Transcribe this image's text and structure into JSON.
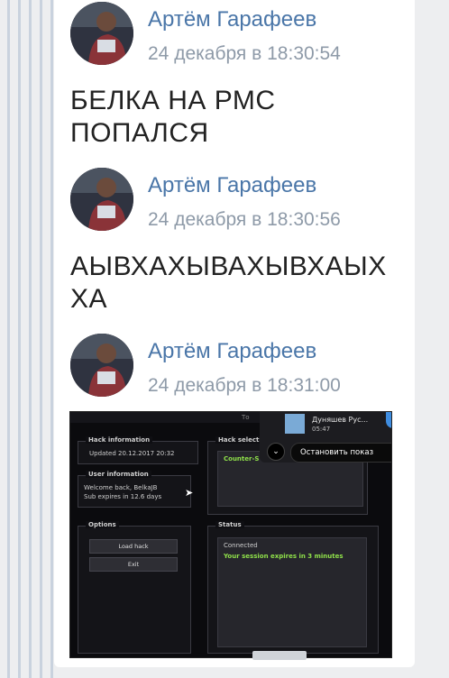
{
  "messages": [
    {
      "author": "Артём Гарафеев",
      "timestamp": "24 декабря в 18:30:54",
      "text_lines": [
        "БЕЛКА НА РМС",
        "ПОПАЛСЯ"
      ]
    },
    {
      "author": "Артём Гарафеев",
      "timestamp": "24 декабря в 18:30:56",
      "text_lines": [
        "АЫВХАХЫВАХЫВХАЫХ",
        "ХА"
      ]
    },
    {
      "author": "Артём Гарафеев",
      "timestamp": "24 декабря в 18:31:00"
    }
  ],
  "attachment": {
    "hack_information": {
      "title": "Hack information",
      "value": "Updated 20.12.2017 20:32"
    },
    "hack_selection": {
      "title": "Hack selectio",
      "value": "Counter-S"
    },
    "user_information": {
      "title": "User information",
      "lines": [
        "Welcome back, BelkaJB",
        "Sub expires in 12.6 days"
      ]
    },
    "options": {
      "title": "Options",
      "buttons": [
        "Load hack",
        "Exit"
      ]
    },
    "status": {
      "title": "Status",
      "lines": [
        "Connected",
        "Your session expires in 3 minutes"
      ]
    },
    "notification": {
      "name": "Дуняшев Рус...",
      "time": "05:47",
      "button": "Остановить показ"
    },
    "top_label": "То"
  },
  "colors": {
    "author": "#4a76a8",
    "timestamp": "#8e9aa8",
    "status_green": "#8fe04a"
  }
}
